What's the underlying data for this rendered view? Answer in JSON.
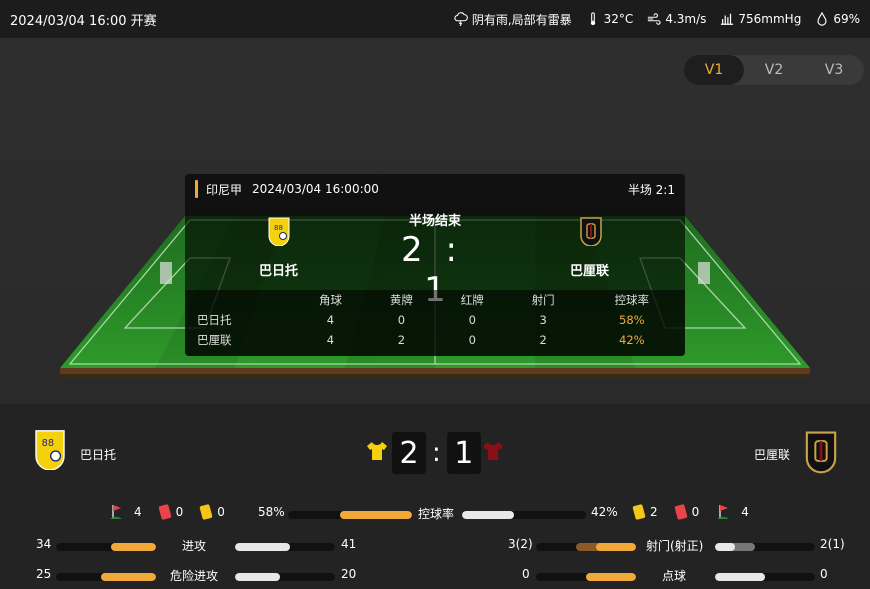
{
  "topbar": {
    "start_time": "2024/03/04 16:00 开赛",
    "weather": "阴有雨,局部有雷暴",
    "temperature": "32°C",
    "wind": "4.3m/s",
    "pressure": "756mmHg",
    "humidity": "69%"
  },
  "versions": [
    "V1",
    "V2",
    "V3"
  ],
  "active_version": "V1",
  "board": {
    "league": "印尼甲",
    "datetime": "2024/03/04 16:00:00",
    "half_score": "半场 2:1",
    "status": "半场结束",
    "home_score": "2",
    "away_score": "1",
    "colon": ":",
    "home_name": "巴日托",
    "away_name": "巴厘联",
    "stat_headers": [
      "角球",
      "黄牌",
      "红牌",
      "射门",
      "控球率"
    ],
    "rows": [
      {
        "team": "巴日托",
        "values": [
          "4",
          "0",
          "0",
          "3",
          "58%"
        ]
      },
      {
        "team": "巴厘联",
        "values": [
          "4",
          "2",
          "0",
          "2",
          "42%"
        ]
      }
    ]
  },
  "summary": {
    "home_name": "巴日托",
    "away_name": "巴厘联",
    "home_score": "2",
    "away_score": "1",
    "colon": ":",
    "home_corners": "4",
    "home_red": "0",
    "home_yellow": "0",
    "away_yellow": "2",
    "away_red": "0",
    "away_corners": "4",
    "colors": {
      "home": "#f5d10c",
      "away": "#8b0f16",
      "accent": "#f2a93b"
    }
  },
  "stats": [
    {
      "label": "控球率",
      "home": "58%",
      "away": "42%",
      "home_ratio": 0.58,
      "away_ratio": 0.42
    },
    {
      "label": "进攻",
      "home": "34",
      "away": "41",
      "home_ratio": 0.45,
      "away_ratio": 0.55
    },
    {
      "label": "危险进攻",
      "home": "25",
      "away": "20",
      "home_ratio": 0.55,
      "away_ratio": 0.45
    },
    {
      "label": "射门(射正)",
      "home": "3(2)",
      "away": "2(1)",
      "home_ratio": 0.6,
      "away_ratio": 0.4,
      "home_inner": 0.4,
      "away_inner": 0.2
    },
    {
      "label": "点球",
      "home": "0",
      "away": "0",
      "home_ratio": 0.5,
      "away_ratio": 0.5
    }
  ]
}
